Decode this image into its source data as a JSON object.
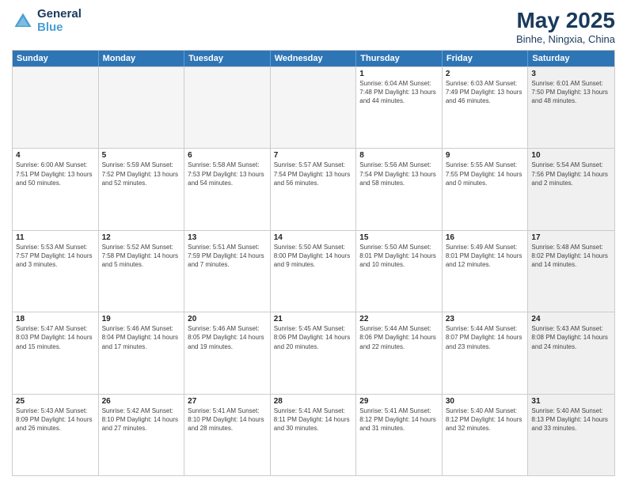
{
  "header": {
    "logo_line1": "General",
    "logo_line2": "Blue",
    "title": "May 2025",
    "subtitle": "Binhe, Ningxia, China"
  },
  "weekdays": [
    "Sunday",
    "Monday",
    "Tuesday",
    "Wednesday",
    "Thursday",
    "Friday",
    "Saturday"
  ],
  "rows": [
    [
      {
        "day": "",
        "info": "",
        "empty": true
      },
      {
        "day": "",
        "info": "",
        "empty": true
      },
      {
        "day": "",
        "info": "",
        "empty": true
      },
      {
        "day": "",
        "info": "",
        "empty": true
      },
      {
        "day": "1",
        "info": "Sunrise: 6:04 AM\nSunset: 7:48 PM\nDaylight: 13 hours\nand 44 minutes.",
        "shaded": false
      },
      {
        "day": "2",
        "info": "Sunrise: 6:03 AM\nSunset: 7:49 PM\nDaylight: 13 hours\nand 46 minutes.",
        "shaded": false
      },
      {
        "day": "3",
        "info": "Sunrise: 6:01 AM\nSunset: 7:50 PM\nDaylight: 13 hours\nand 48 minutes.",
        "shaded": true
      }
    ],
    [
      {
        "day": "4",
        "info": "Sunrise: 6:00 AM\nSunset: 7:51 PM\nDaylight: 13 hours\nand 50 minutes.",
        "shaded": false
      },
      {
        "day": "5",
        "info": "Sunrise: 5:59 AM\nSunset: 7:52 PM\nDaylight: 13 hours\nand 52 minutes.",
        "shaded": false
      },
      {
        "day": "6",
        "info": "Sunrise: 5:58 AM\nSunset: 7:53 PM\nDaylight: 13 hours\nand 54 minutes.",
        "shaded": false
      },
      {
        "day": "7",
        "info": "Sunrise: 5:57 AM\nSunset: 7:54 PM\nDaylight: 13 hours\nand 56 minutes.",
        "shaded": false
      },
      {
        "day": "8",
        "info": "Sunrise: 5:56 AM\nSunset: 7:54 PM\nDaylight: 13 hours\nand 58 minutes.",
        "shaded": false
      },
      {
        "day": "9",
        "info": "Sunrise: 5:55 AM\nSunset: 7:55 PM\nDaylight: 14 hours\nand 0 minutes.",
        "shaded": false
      },
      {
        "day": "10",
        "info": "Sunrise: 5:54 AM\nSunset: 7:56 PM\nDaylight: 14 hours\nand 2 minutes.",
        "shaded": true
      }
    ],
    [
      {
        "day": "11",
        "info": "Sunrise: 5:53 AM\nSunset: 7:57 PM\nDaylight: 14 hours\nand 3 minutes.",
        "shaded": false
      },
      {
        "day": "12",
        "info": "Sunrise: 5:52 AM\nSunset: 7:58 PM\nDaylight: 14 hours\nand 5 minutes.",
        "shaded": false
      },
      {
        "day": "13",
        "info": "Sunrise: 5:51 AM\nSunset: 7:59 PM\nDaylight: 14 hours\nand 7 minutes.",
        "shaded": false
      },
      {
        "day": "14",
        "info": "Sunrise: 5:50 AM\nSunset: 8:00 PM\nDaylight: 14 hours\nand 9 minutes.",
        "shaded": false
      },
      {
        "day": "15",
        "info": "Sunrise: 5:50 AM\nSunset: 8:01 PM\nDaylight: 14 hours\nand 10 minutes.",
        "shaded": false
      },
      {
        "day": "16",
        "info": "Sunrise: 5:49 AM\nSunset: 8:01 PM\nDaylight: 14 hours\nand 12 minutes.",
        "shaded": false
      },
      {
        "day": "17",
        "info": "Sunrise: 5:48 AM\nSunset: 8:02 PM\nDaylight: 14 hours\nand 14 minutes.",
        "shaded": true
      }
    ],
    [
      {
        "day": "18",
        "info": "Sunrise: 5:47 AM\nSunset: 8:03 PM\nDaylight: 14 hours\nand 15 minutes.",
        "shaded": false
      },
      {
        "day": "19",
        "info": "Sunrise: 5:46 AM\nSunset: 8:04 PM\nDaylight: 14 hours\nand 17 minutes.",
        "shaded": false
      },
      {
        "day": "20",
        "info": "Sunrise: 5:46 AM\nSunset: 8:05 PM\nDaylight: 14 hours\nand 19 minutes.",
        "shaded": false
      },
      {
        "day": "21",
        "info": "Sunrise: 5:45 AM\nSunset: 8:06 PM\nDaylight: 14 hours\nand 20 minutes.",
        "shaded": false
      },
      {
        "day": "22",
        "info": "Sunrise: 5:44 AM\nSunset: 8:06 PM\nDaylight: 14 hours\nand 22 minutes.",
        "shaded": false
      },
      {
        "day": "23",
        "info": "Sunrise: 5:44 AM\nSunset: 8:07 PM\nDaylight: 14 hours\nand 23 minutes.",
        "shaded": false
      },
      {
        "day": "24",
        "info": "Sunrise: 5:43 AM\nSunset: 8:08 PM\nDaylight: 14 hours\nand 24 minutes.",
        "shaded": true
      }
    ],
    [
      {
        "day": "25",
        "info": "Sunrise: 5:43 AM\nSunset: 8:09 PM\nDaylight: 14 hours\nand 26 minutes.",
        "shaded": false
      },
      {
        "day": "26",
        "info": "Sunrise: 5:42 AM\nSunset: 8:10 PM\nDaylight: 14 hours\nand 27 minutes.",
        "shaded": false
      },
      {
        "day": "27",
        "info": "Sunrise: 5:41 AM\nSunset: 8:10 PM\nDaylight: 14 hours\nand 28 minutes.",
        "shaded": false
      },
      {
        "day": "28",
        "info": "Sunrise: 5:41 AM\nSunset: 8:11 PM\nDaylight: 14 hours\nand 30 minutes.",
        "shaded": false
      },
      {
        "day": "29",
        "info": "Sunrise: 5:41 AM\nSunset: 8:12 PM\nDaylight: 14 hours\nand 31 minutes.",
        "shaded": false
      },
      {
        "day": "30",
        "info": "Sunrise: 5:40 AM\nSunset: 8:12 PM\nDaylight: 14 hours\nand 32 minutes.",
        "shaded": false
      },
      {
        "day": "31",
        "info": "Sunrise: 5:40 AM\nSunset: 8:13 PM\nDaylight: 14 hours\nand 33 minutes.",
        "shaded": true
      }
    ]
  ]
}
